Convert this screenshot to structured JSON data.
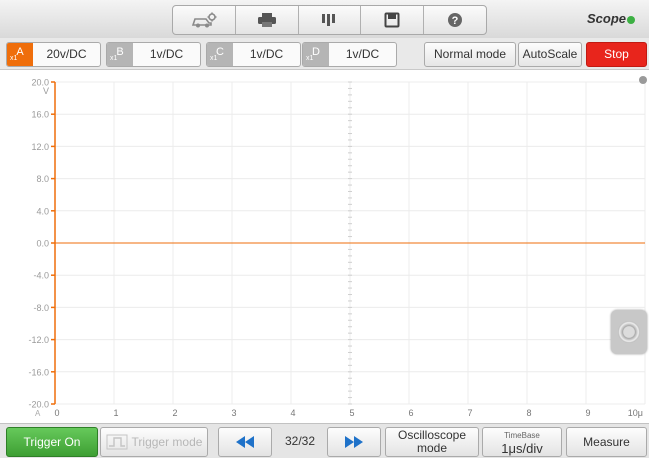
{
  "toolbar": {
    "icons": [
      "car-settings-icon",
      "printer-icon",
      "pause-icon",
      "save-icon",
      "help-icon"
    ],
    "brand": "Scope"
  },
  "channels": [
    {
      "id": "A",
      "sub": "x1",
      "value": "20v/DC",
      "active": true
    },
    {
      "id": "B",
      "sub": "x1",
      "value": "1v/DC",
      "active": false
    },
    {
      "id": "C",
      "sub": "x1",
      "value": "1v/DC",
      "active": false
    },
    {
      "id": "D",
      "sub": "x1",
      "value": "1v/DC",
      "active": false
    }
  ],
  "controls": {
    "normal_mode": "Normal mode",
    "autoscale": "AutoScale",
    "stop": "Stop"
  },
  "scope": {
    "y_unit": "V",
    "y_ticks": [
      "20.0",
      "16.0",
      "12.0",
      "8.0",
      "4.0",
      "0.0",
      "-4.0",
      "-8.0",
      "-12.0",
      "-16.0",
      "-20.0"
    ],
    "x_origin_label": "A",
    "x_ticks": [
      "0",
      "1",
      "2",
      "3",
      "4",
      "5",
      "6",
      "7",
      "8",
      "9",
      "10μ"
    ],
    "trace_level": 0.0,
    "trace_color": "#ef6e0b"
  },
  "bottom": {
    "trigger_on": "Trigger On",
    "trigger_mode": "Trigger mode",
    "page": "32/32",
    "osc_mode_line1": "Oscilloscope",
    "osc_mode_line2": "mode",
    "timebase_label": "TimeBase",
    "timebase_value": "1μs/div",
    "measure": "Measure"
  },
  "colors": {
    "accent": "#ef6e0b",
    "stop": "#e8251c",
    "trigger": "#4cae40",
    "nav_arrows": "#1f72c9"
  }
}
